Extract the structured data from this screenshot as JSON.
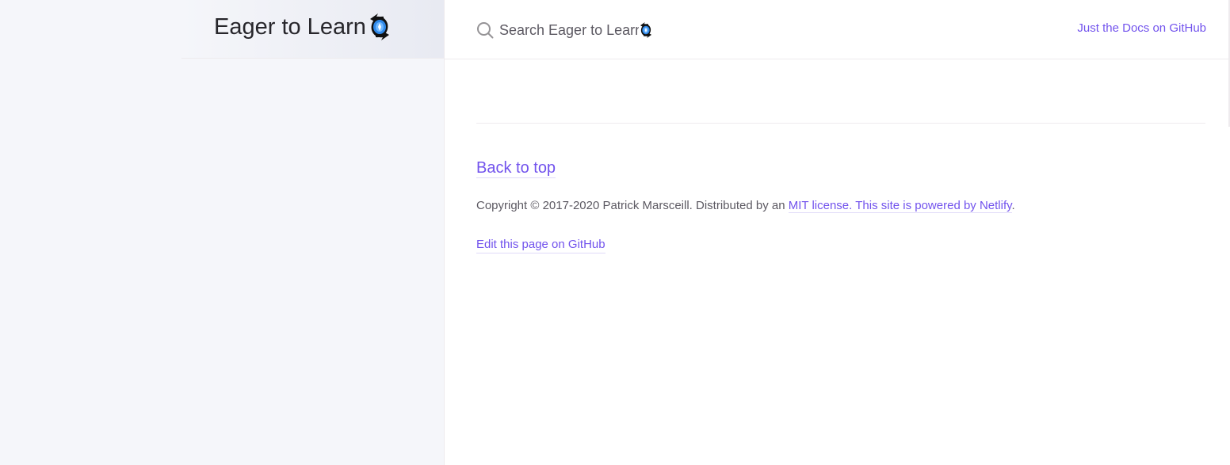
{
  "header": {
    "site_title": "Eager to Learn",
    "logo_icon": "swirl-logo-icon",
    "search_placeholder": "Search Eager to Learn",
    "aux_link": "Just the Docs on GitHub"
  },
  "footer": {
    "back_to_top": "Back to top",
    "copyright_prefix": "Copyright © 2017-2020 Patrick Marsceill. Distributed by an ",
    "mit_license": "MIT license.",
    "space": " ",
    "netlify_link": "This site is powered by Netlify",
    "period": ".",
    "edit_page": "Edit this page on GitHub"
  },
  "colors": {
    "link": "#7253ed",
    "text": "#5c5962",
    "title": "#27262b",
    "sidebar_bg": "#f5f6fa",
    "border": "#eeebee"
  }
}
